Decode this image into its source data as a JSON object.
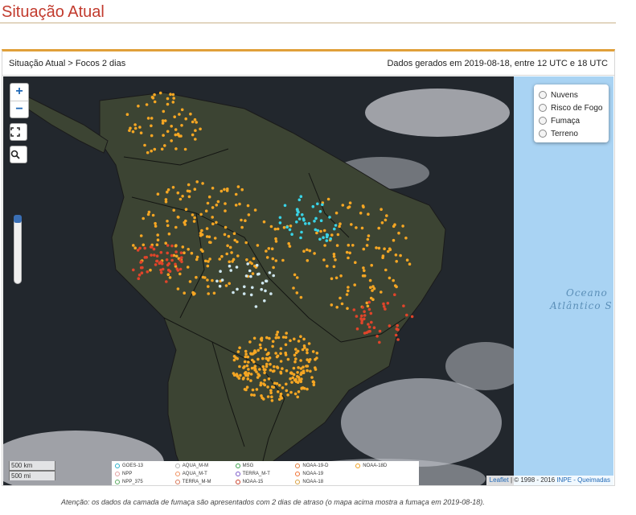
{
  "page": {
    "title": "Situação Atual"
  },
  "panel": {
    "breadcrumb": "Situação Atual > Focos 2 dias",
    "data_info": "Dados gerados em 2019-08-18, entre 12 UTC e 18 UTC"
  },
  "map_controls": {
    "zoom_in": "+",
    "zoom_out": "−",
    "fullscreen_icon": "fullscreen-icon",
    "search_icon": "search-icon",
    "zoom_level_fraction": 0.0
  },
  "layers": [
    {
      "label": "Nuvens",
      "checked": false
    },
    {
      "label": "Risco de Fogo",
      "checked": false
    },
    {
      "label": "Fumaça",
      "checked": false
    },
    {
      "label": "Terreno",
      "checked": false
    }
  ],
  "ocean_label": {
    "line1": "Oceano",
    "line2": "Atlântico S"
  },
  "scale": {
    "km": "500 km",
    "mi": "500 mi"
  },
  "legend": [
    {
      "label": "GOES-13",
      "color": "#2ab0c9"
    },
    {
      "label": "AQUA_M-M",
      "color": "#b6b6b6"
    },
    {
      "label": "MSG",
      "color": "#3aa04a"
    },
    {
      "label": "NOAA-19-D",
      "color": "#e07b39"
    },
    {
      "label": "NOAA-18D",
      "color": "#f0a020"
    },
    {
      "label": "NPP",
      "color": "#e0a0a0"
    },
    {
      "label": "AQUA_M-T",
      "color": "#f09060"
    },
    {
      "label": "TERRA_M-T",
      "color": "#7a58c8"
    },
    {
      "label": "NOAA-19",
      "color": "#f07030"
    },
    {
      "label": "",
      "color": ""
    },
    {
      "label": "NPP_375",
      "color": "#5aa860"
    },
    {
      "label": "TERRA_M-M",
      "color": "#d8785a"
    },
    {
      "label": "NOAA-15",
      "color": "#c8402a"
    },
    {
      "label": "NOAA-18",
      "color": "#d8a040"
    },
    {
      "label": "",
      "color": ""
    }
  ],
  "attribution": {
    "leaflet": "Leaflet",
    "copyright": "| © 1998 - 2016",
    "org": "INPE - Queimadas"
  },
  "footnote": "Atenção: os dados da camada de fumaça são apresentados com 2 dias de atraso (o mapa acima mostra a fumaça em 2019-08-18).",
  "colors": {
    "title": "#c23b2e",
    "header_accent": "#e0a03a",
    "ocean": "#a9d3f3",
    "land": "#3b4230",
    "fire_orange": "#f5a623",
    "fire_red": "#e0442a",
    "fire_cyan": "#39d3e6"
  }
}
